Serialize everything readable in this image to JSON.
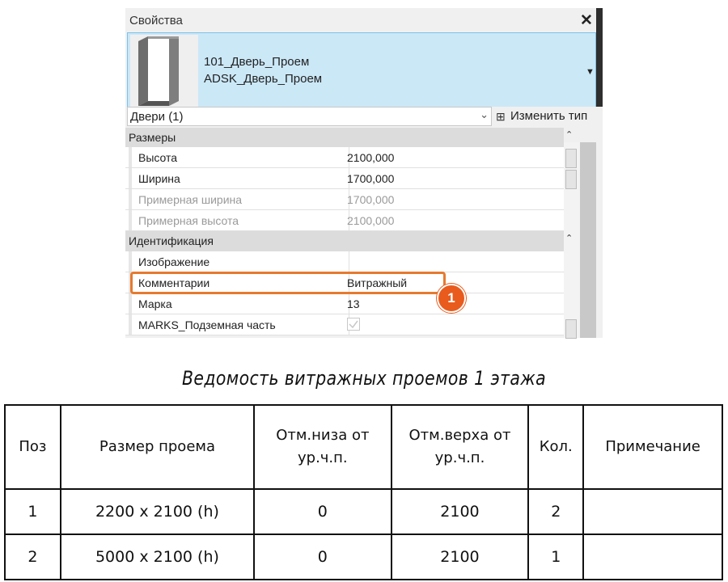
{
  "palette": {
    "title": "Свойства",
    "close_icon": "close-icon",
    "type_selector": {
      "family": "101_Дверь_Проем",
      "type": "ADSK_Дверь_Проем"
    },
    "filter": {
      "value": "Двери (1)"
    },
    "edit_type_label": "Изменить тип",
    "groups": [
      {
        "name": "Размеры",
        "props": [
          {
            "key": "Высота",
            "value": "2100,000"
          },
          {
            "key": "Ширина",
            "value": "1700,000"
          },
          {
            "key": "Примерная ширина",
            "value": "1700,000"
          },
          {
            "key": "Примерная высота",
            "value": "2100,000"
          }
        ]
      },
      {
        "name": "Идентификация",
        "props": [
          {
            "key": "Изображение",
            "value": ""
          },
          {
            "key": "Комментарии",
            "value": "Витражный"
          },
          {
            "key": "Марка",
            "value": "13"
          },
          {
            "key": "MARKS_Подземная часть",
            "value": ""
          }
        ]
      }
    ],
    "callout_number": "1",
    "accent_color": "#e67a2f",
    "selection_color": "#cbe8f7"
  },
  "schedule": {
    "title": "Ведомость витражных проемов 1 этажа",
    "headers": [
      "Поз",
      "Размер проема",
      "Отм.низа от ур.ч.п.",
      "Отм.верха от ур.ч.п.",
      "Кол.",
      "Примечание"
    ],
    "rows": [
      [
        "1",
        "2200 x 2100 (h)",
        "0",
        "2100",
        "2",
        ""
      ],
      [
        "2",
        "5000 x 2100 (h)",
        "0",
        "2100",
        "1",
        ""
      ]
    ]
  }
}
